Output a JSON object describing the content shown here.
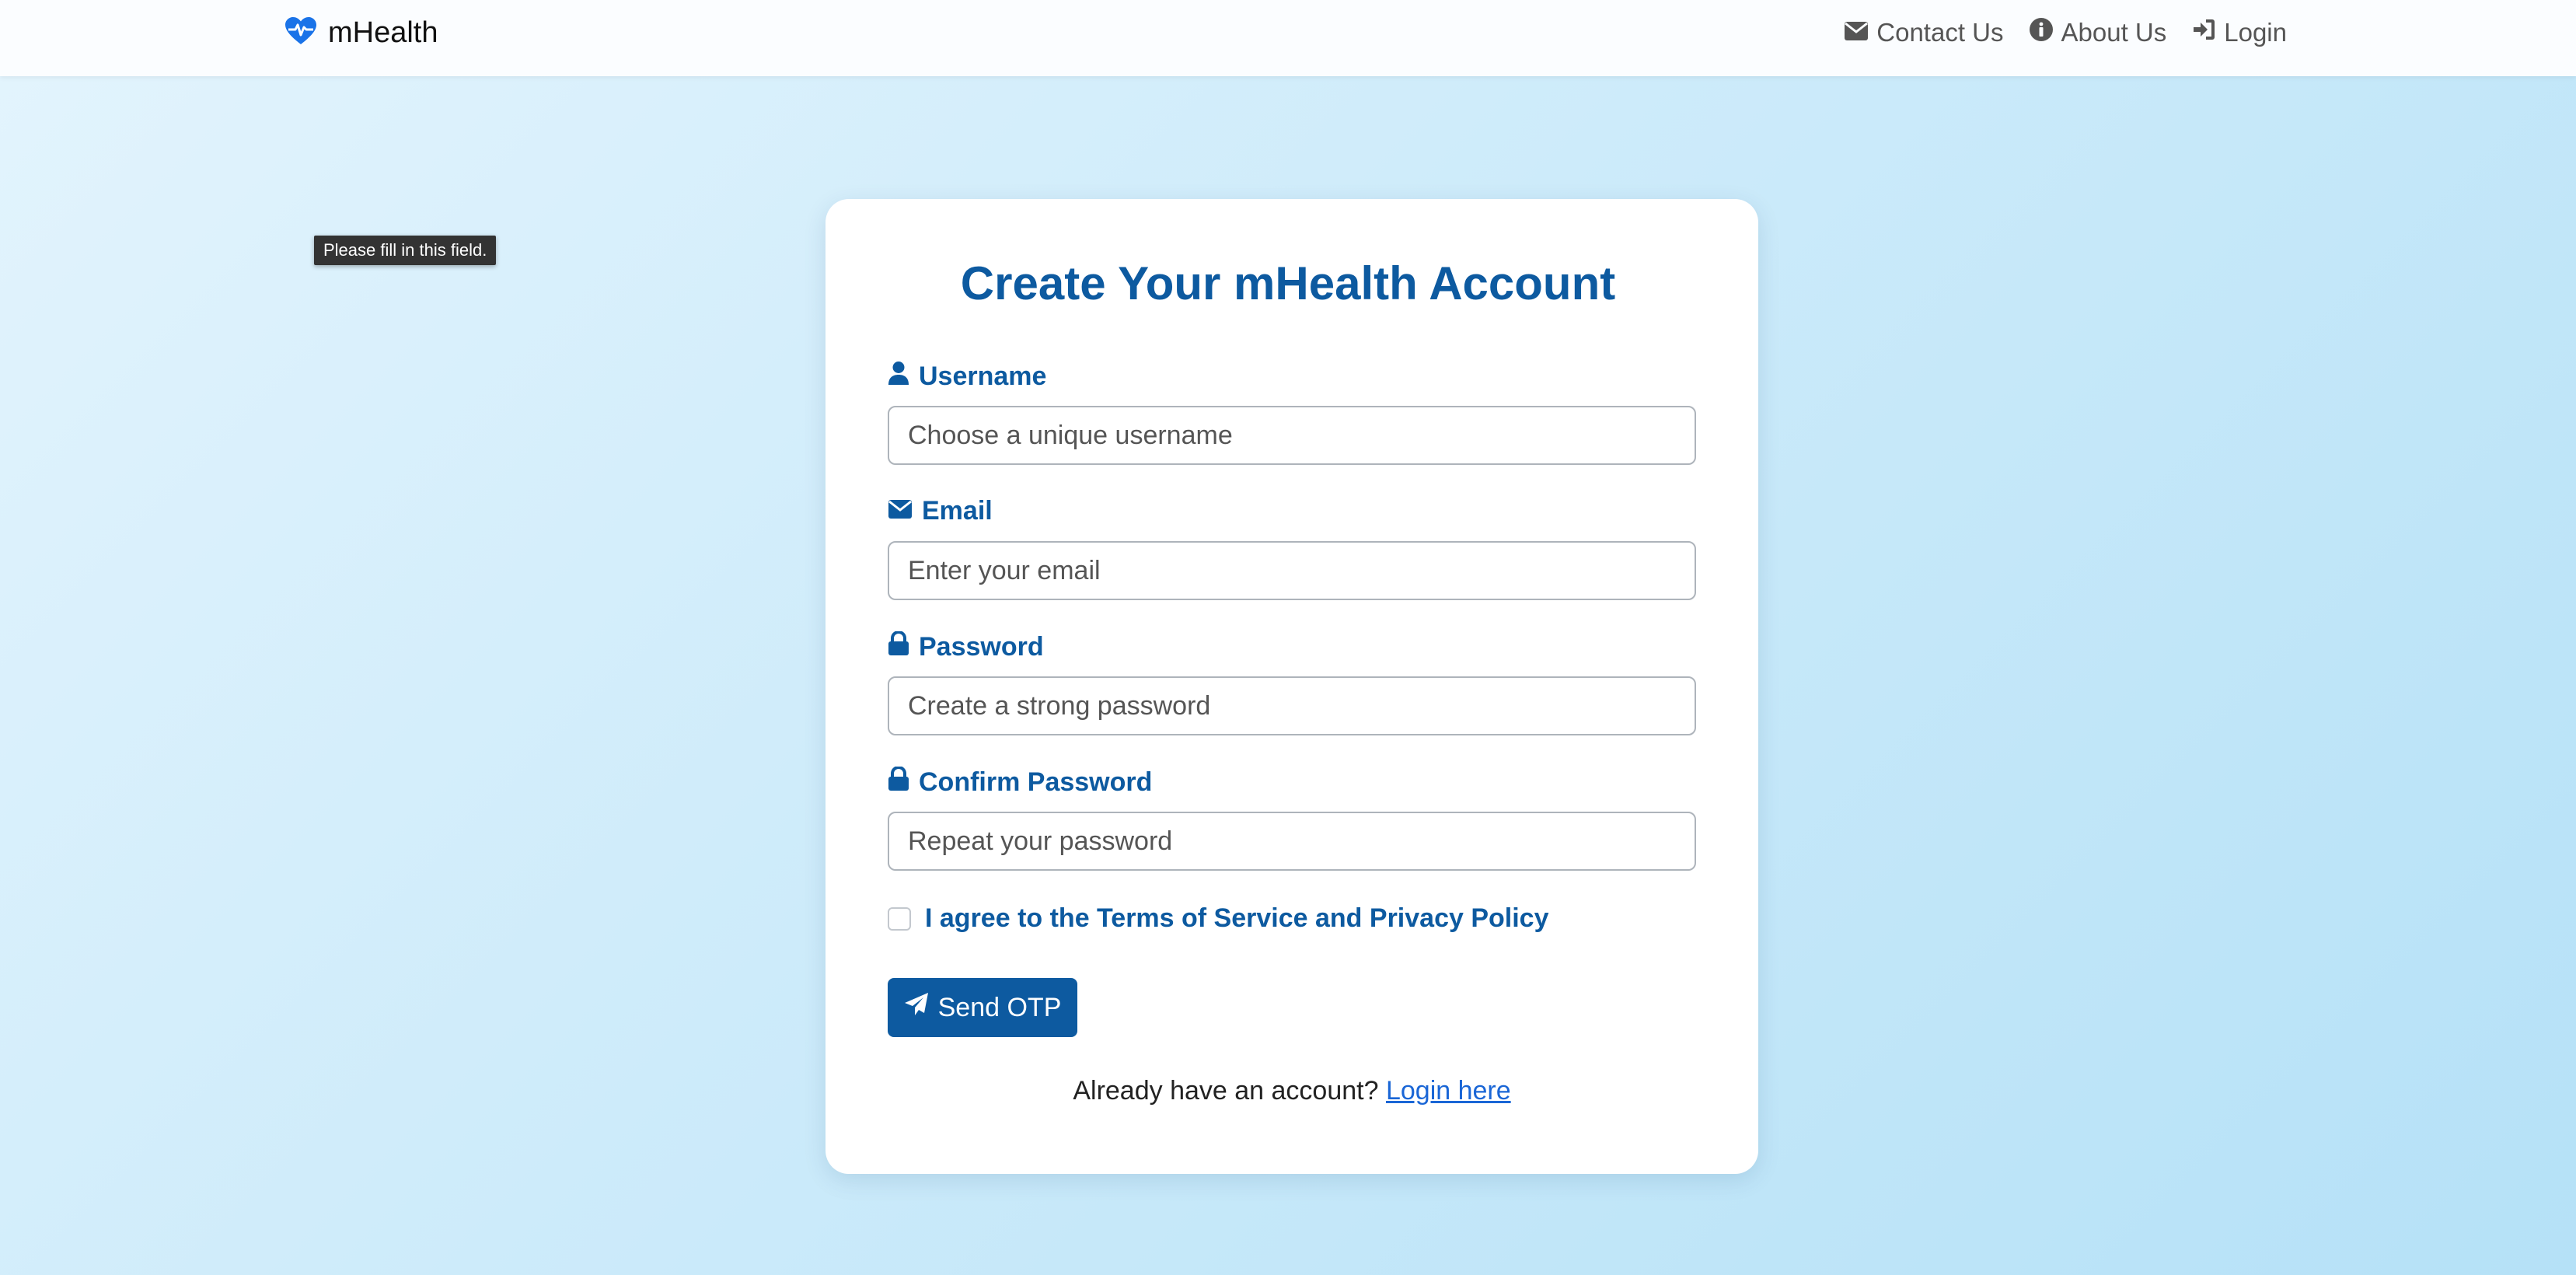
{
  "navbar": {
    "brand": "mHealth",
    "links": [
      {
        "label": "Contact Us",
        "icon": "envelope-icon"
      },
      {
        "label": "About Us",
        "icon": "info-circle-icon"
      },
      {
        "label": "Login",
        "icon": "sign-in-icon"
      }
    ]
  },
  "tooltip": "Please fill in this field.",
  "form": {
    "title": "Create Your mHealth Account",
    "fields": [
      {
        "label": "Username",
        "icon": "user-icon",
        "placeholder": "Choose a unique username",
        "value": ""
      },
      {
        "label": "Email",
        "icon": "envelope-icon",
        "placeholder": "Enter your email",
        "value": ""
      },
      {
        "label": "Password",
        "icon": "lock-icon",
        "placeholder": "Create a strong password",
        "value": ""
      },
      {
        "label": "Confirm Password",
        "icon": "lock-icon",
        "placeholder": "Repeat your password",
        "value": ""
      }
    ],
    "agree_label": "I agree to the Terms of Service and Privacy Policy",
    "agree_checked": false,
    "submit_label": "Send OTP",
    "footer_text": "Already have an account?",
    "footer_link": "Login here"
  },
  "colors": {
    "primary": "#0d5aa0",
    "link": "#1a66d6",
    "brand_icon": "#1a73e8"
  }
}
